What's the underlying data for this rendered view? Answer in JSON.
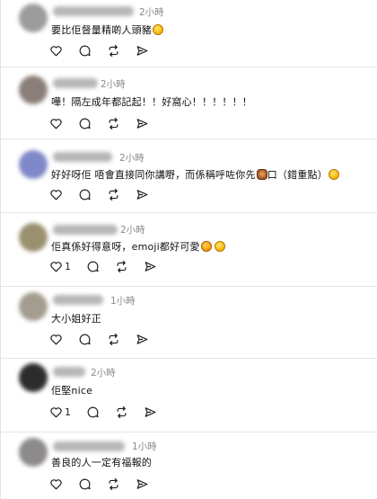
{
  "posts": [
    {
      "time": "2小時",
      "text": "要比佢督量精啲人頭豬",
      "emoji": "yellow",
      "like_count": ""
    },
    {
      "time": "2小時",
      "text": "嘩！隔左成年都記起！！好窩心！！！！！！",
      "emoji": "",
      "like_count": ""
    },
    {
      "time": "2小時",
      "text": "好好呀佢 唔會直接同你講嘢，而係稱呼咗你先",
      "emoji2": "person",
      "text_tail": "口（錯重點）",
      "emoji": "yellow",
      "like_count": ""
    },
    {
      "time": "2小時",
      "text": "佢真係好得意呀，emoji都好可愛",
      "emoji": "orange",
      "emoji_b": "yellow",
      "like_count": "1"
    },
    {
      "time": "1小時",
      "text": "大小姐好正",
      "emoji": "",
      "like_count": ""
    },
    {
      "time": "2小時",
      "text": "佢堅nice",
      "emoji": "",
      "like_count": "1"
    },
    {
      "time": "1小時",
      "text": "善良的人一定有福報的",
      "emoji": "",
      "like_count": ""
    }
  ],
  "icons": [
    "heart-icon",
    "comment-icon",
    "repost-icon",
    "share-icon"
  ]
}
